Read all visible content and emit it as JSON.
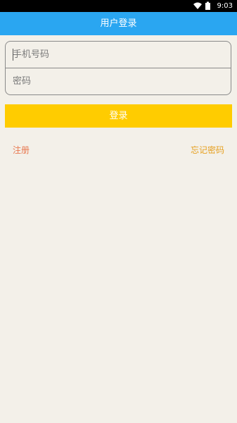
{
  "status_bar": {
    "time": "9:03",
    "icons": [
      "wifi-icon",
      "battery-icon"
    ]
  },
  "header": {
    "title": "用户登录"
  },
  "form": {
    "phone_placeholder": "手机号码",
    "phone_value": "",
    "password_placeholder": "密码",
    "password_value": ""
  },
  "actions": {
    "login_label": "登录",
    "register_label": "注册",
    "forgot_label": "忘记密码"
  },
  "colors": {
    "header_bg": "#2aa6f1",
    "button_bg": "#ffcc00",
    "page_bg": "#f3f0e9",
    "register_text": "#e87850",
    "forgot_text": "#e6a020"
  }
}
